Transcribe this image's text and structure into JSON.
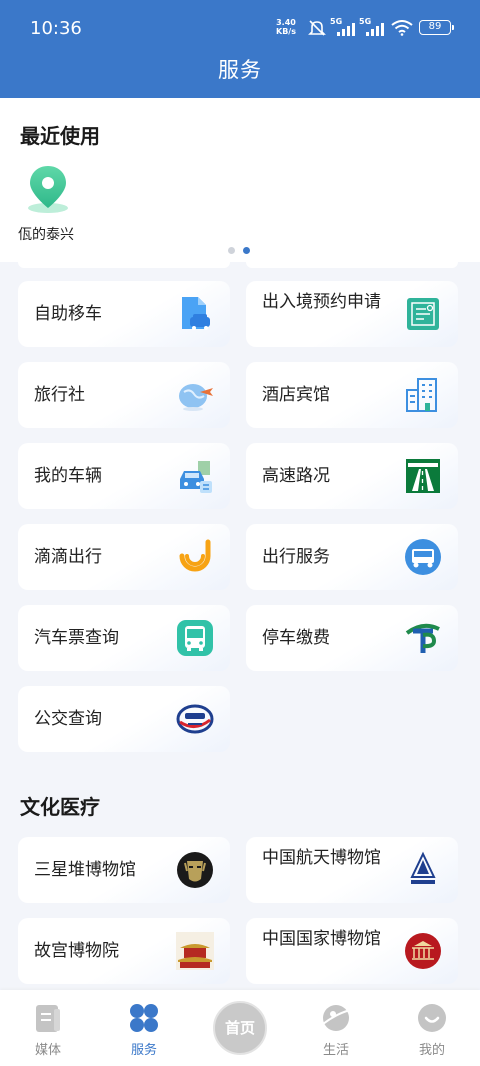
{
  "status_bar": {
    "time": "10:36",
    "net_speed_value": "3.40",
    "net_speed_unit": "KB/s",
    "signal_1": "5G",
    "signal_2": "5G",
    "battery": "89"
  },
  "header": {
    "title": "服务"
  },
  "recent": {
    "title": "最近使用",
    "items": [
      {
        "label": "佤的泰兴",
        "icon": "location-pin-icon"
      }
    ],
    "pager": {
      "count": 2,
      "active": 1
    }
  },
  "services": [
    {
      "label": "自助移车",
      "icon": "document-car-icon"
    },
    {
      "label": "出入境预约申请",
      "icon": "certificate-icon"
    },
    {
      "label": "旅行社",
      "icon": "globe-plane-icon"
    },
    {
      "label": "酒店宾馆",
      "icon": "building-icon"
    },
    {
      "label": "我的车辆",
      "icon": "car-document-icon"
    },
    {
      "label": "高速路况",
      "icon": "highway-icon"
    },
    {
      "label": "滴滴出行",
      "icon": "didi-icon"
    },
    {
      "label": "出行服务",
      "icon": "bus-circle-icon"
    },
    {
      "label": "汽车票查询",
      "icon": "bus-icon"
    },
    {
      "label": "停车缴费",
      "icon": "parking-icon"
    },
    {
      "label": "公交查询",
      "icon": "bus-logo-icon"
    }
  ],
  "culture": {
    "title": "文化医疗",
    "items": [
      {
        "label": "三星堆博物馆",
        "icon": "bronze-mask-icon"
      },
      {
        "label": "中国航天博物馆",
        "icon": "aerospace-logo-icon"
      },
      {
        "label": "故宫博物院",
        "icon": "palace-icon"
      },
      {
        "label": "中国国家博物馆",
        "icon": "national-museum-icon"
      }
    ]
  },
  "tabbar": {
    "tabs": [
      {
        "label": "媒体",
        "icon": "media-icon"
      },
      {
        "label": "服务",
        "icon": "service-grid-icon",
        "active": true
      },
      {
        "label": "首页",
        "icon": "home-logo-icon"
      },
      {
        "label": "生活",
        "icon": "planet-icon"
      },
      {
        "label": "我的",
        "icon": "smile-icon"
      }
    ]
  },
  "colors": {
    "header": "#3b78c9",
    "active_tab": "#3b78c9",
    "inactive_tab": "#8a8a8a",
    "page_bg": "#f3f5fa"
  }
}
